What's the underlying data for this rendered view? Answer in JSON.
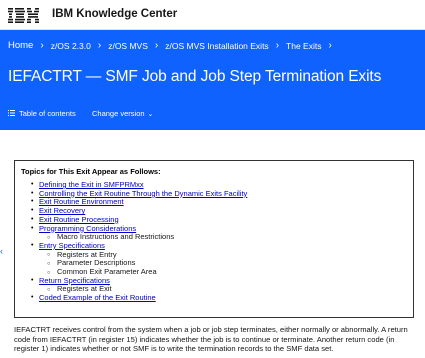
{
  "header": {
    "logo_text": "IBM",
    "brand": "IBM Knowledge Center"
  },
  "breadcrumb": {
    "items": [
      "Home",
      "z/OS 2.3.0",
      "z/OS MVS",
      "z/OS MVS Installation Exits",
      "The Exits"
    ]
  },
  "page": {
    "title": "IEFACTRT — SMF Job and Job Step Termination Exits"
  },
  "actions": {
    "toc_label": "Table of contents",
    "change_version_label": "Change version"
  },
  "topics": {
    "heading": "Topics for This Exit Appear as Follows:",
    "items": [
      {
        "label": "Defining the Exit in SMFPRMxx",
        "link": true
      },
      {
        "label": "Controlling the Exit Routine Through the Dynamic Exits Facility",
        "link": true
      },
      {
        "label": "Exit Routine Environment",
        "link": true
      },
      {
        "label": "Exit Recovery",
        "link": true
      },
      {
        "label": "Exit Routine Processing",
        "link": true
      },
      {
        "label": "Programming Considerations",
        "link": true
      },
      {
        "label": "Macro Instructions and Restrictions",
        "link": false
      },
      {
        "label": "Entry Specifications",
        "link": true
      },
      {
        "label": "Registers at Entry",
        "link": false
      },
      {
        "label": "Parameter Descriptions",
        "link": false
      },
      {
        "label": "Common Exit Parameter Area",
        "link": false
      },
      {
        "label": "Return Specifications",
        "link": true
      },
      {
        "label": "Registers at Exit",
        "link": false
      },
      {
        "label": "Coded Example of the Exit Routine",
        "link": true
      }
    ]
  },
  "body": {
    "paragraph": "IEFACTRT receives control from the system when a job or job step terminates, either normally or abnormally. A return code from IEFACTRT (in register 15) indicates whether the job is to continue or terminate. Another return code (in register 1) indicates whether or not SMF is to write the termination records to the SMF data set."
  },
  "colors": {
    "brand_blue": "#0f62fe",
    "link": "#0000cc"
  },
  "icons": [
    "ibm-logo-icon",
    "chevron-right-icon",
    "list-icon",
    "chevron-down-icon",
    "chevron-left-icon"
  ]
}
